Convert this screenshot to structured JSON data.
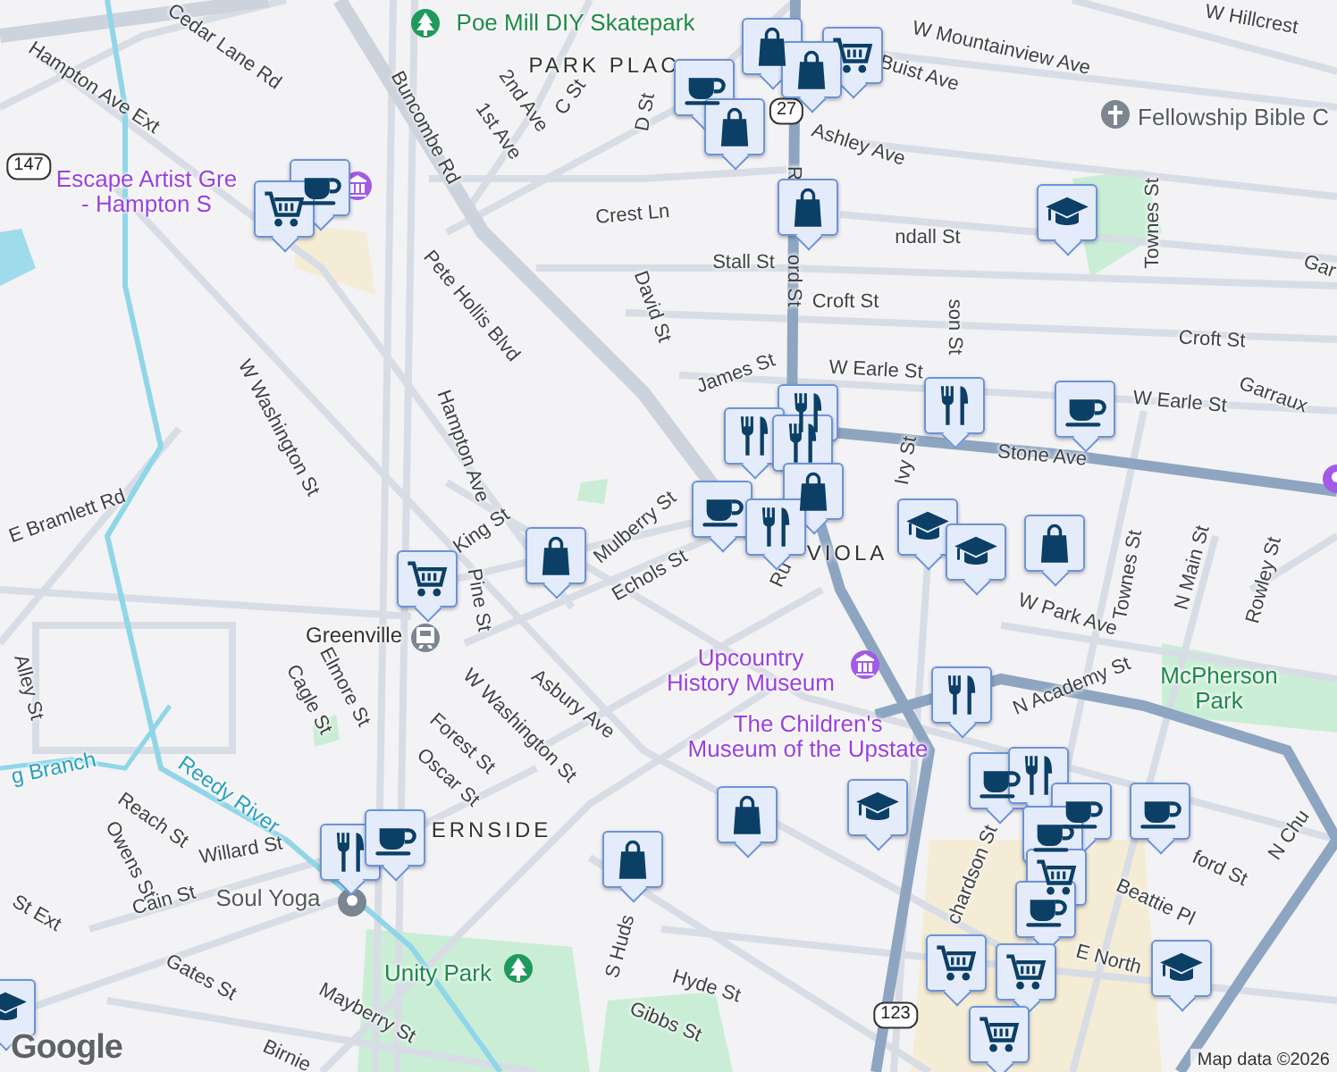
{
  "map": {
    "labels": [
      {
        "text": "Cedar Lane Rd",
        "kind": "street"
      },
      {
        "text": "Hampton Ave Ext",
        "kind": "street"
      },
      {
        "text": "147",
        "kind": "shield"
      },
      {
        "text": "Escape Artist Gre\n- Hampton S",
        "kind": "museum"
      },
      {
        "text": "Poe Mill DIY Skatepark",
        "kind": "park"
      },
      {
        "text": "PARK PLAC",
        "kind": "neighborhood"
      },
      {
        "text": "Buncombe Rd",
        "kind": "street"
      },
      {
        "text": "2nd Ave",
        "kind": "street"
      },
      {
        "text": "1st Ave",
        "kind": "street"
      },
      {
        "text": "C St",
        "kind": "street"
      },
      {
        "text": "D St",
        "kind": "street"
      },
      {
        "text": "W Mountainview Ave",
        "kind": "street"
      },
      {
        "text": "Buist Ave",
        "kind": "street"
      },
      {
        "text": "W Hillcrest",
        "kind": "street"
      },
      {
        "text": "Ashley Ave",
        "kind": "street"
      },
      {
        "text": "ndall St",
        "kind": "street"
      },
      {
        "text": "Fellowship Bible C",
        "kind": "place"
      },
      {
        "text": "Crest Ln",
        "kind": "street"
      },
      {
        "text": "Stall St",
        "kind": "street"
      },
      {
        "text": "Croft St",
        "kind": "street"
      },
      {
        "text": "Croft St",
        "kind": "street"
      },
      {
        "text": "David St",
        "kind": "street"
      },
      {
        "text": "Pete Hollis Blvd",
        "kind": "street"
      },
      {
        "text": "James St",
        "kind": "street"
      },
      {
        "text": "W Earle St",
        "kind": "street"
      },
      {
        "text": "W Earle St",
        "kind": "street"
      },
      {
        "text": "R",
        "kind": "street"
      },
      {
        "text": "ord St",
        "kind": "street"
      },
      {
        "text": "Gar",
        "kind": "street"
      },
      {
        "text": "Garraux",
        "kind": "street"
      },
      {
        "text": "son St",
        "kind": "street"
      },
      {
        "text": "Townes St",
        "kind": "street"
      },
      {
        "text": "Stone Ave",
        "kind": "street"
      },
      {
        "text": "Hampton Ave",
        "kind": "street"
      },
      {
        "text": "W Washington St",
        "kind": "street"
      },
      {
        "text": "E Bramlett Rd",
        "kind": "street"
      },
      {
        "text": "King St",
        "kind": "street"
      },
      {
        "text": "Mulberry St",
        "kind": "street"
      },
      {
        "text": "Echols St",
        "kind": "street"
      },
      {
        "text": "VIOLA",
        "kind": "neighborhood"
      },
      {
        "text": "Ru",
        "kind": "street"
      },
      {
        "text": "Pine St",
        "kind": "street"
      },
      {
        "text": "Ivy St",
        "kind": "street"
      },
      {
        "text": "W Park Ave",
        "kind": "street"
      },
      {
        "text": "Townes St",
        "kind": "street"
      },
      {
        "text": "N Main St",
        "kind": "street"
      },
      {
        "text": "Rowley St",
        "kind": "street"
      },
      {
        "text": "Greenville",
        "kind": "transit"
      },
      {
        "text": "Alley St",
        "kind": "street"
      },
      {
        "text": "Cagle St",
        "kind": "street"
      },
      {
        "text": "Elmore St",
        "kind": "street"
      },
      {
        "text": "Forest St",
        "kind": "street"
      },
      {
        "text": "Oscar St",
        "kind": "street"
      },
      {
        "text": "W Washington St",
        "kind": "street"
      },
      {
        "text": "Asbury Ave",
        "kind": "street"
      },
      {
        "text": "Upcountry\nHistory Museum",
        "kind": "museum"
      },
      {
        "text": "The Children's\nMuseum of the Upstate",
        "kind": "museum"
      },
      {
        "text": "N Academy St",
        "kind": "street"
      },
      {
        "text": "McPherson\nPark",
        "kind": "park"
      },
      {
        "text": "g Branch",
        "kind": "water"
      },
      {
        "text": "Reedy River",
        "kind": "water"
      },
      {
        "text": "Reach St",
        "kind": "street"
      },
      {
        "text": "Owens St",
        "kind": "street"
      },
      {
        "text": "Willard St",
        "kind": "street"
      },
      {
        "text": "Cain St",
        "kind": "street"
      },
      {
        "text": "St Ext",
        "kind": "street"
      },
      {
        "text": "ERNSIDE",
        "kind": "neighborhood"
      },
      {
        "text": "Soul Yoga",
        "kind": "place"
      },
      {
        "text": "Unity Park",
        "kind": "park"
      },
      {
        "text": "S Huds",
        "kind": "street"
      },
      {
        "text": "Hyde St",
        "kind": "street"
      },
      {
        "text": "Gibbs St",
        "kind": "street"
      },
      {
        "text": "Gates St",
        "kind": "street"
      },
      {
        "text": "Mayberry St",
        "kind": "street"
      },
      {
        "text": "Birnie",
        "kind": "street"
      },
      {
        "text": "ford St",
        "kind": "street"
      },
      {
        "text": "Beattie Pl",
        "kind": "street"
      },
      {
        "text": "E North",
        "kind": "street"
      },
      {
        "text": "chardson St",
        "kind": "street"
      },
      {
        "text": "N Chu",
        "kind": "street"
      },
      {
        "text": "123",
        "kind": "shield"
      },
      {
        "text": "27",
        "kind": "shield"
      }
    ],
    "markers": [
      {
        "kind": "cafe"
      },
      {
        "kind": "grocery"
      },
      {
        "kind": "shop"
      },
      {
        "kind": "grocery"
      },
      {
        "kind": "shop"
      },
      {
        "kind": "cafe"
      },
      {
        "kind": "shop"
      },
      {
        "kind": "shop"
      },
      {
        "kind": "school"
      },
      {
        "kind": "restaurant"
      },
      {
        "kind": "cafe"
      },
      {
        "kind": "restaurant"
      },
      {
        "kind": "restaurant"
      },
      {
        "kind": "restaurant"
      },
      {
        "kind": "shop"
      },
      {
        "kind": "cafe"
      },
      {
        "kind": "restaurant"
      },
      {
        "kind": "grocery"
      },
      {
        "kind": "shop"
      },
      {
        "kind": "school"
      },
      {
        "kind": "school"
      },
      {
        "kind": "shop"
      },
      {
        "kind": "restaurant"
      },
      {
        "kind": "shop"
      },
      {
        "kind": "school"
      },
      {
        "kind": "shop"
      },
      {
        "kind": "restaurant"
      },
      {
        "kind": "cafe"
      },
      {
        "kind": "cafe"
      },
      {
        "kind": "restaurant"
      },
      {
        "kind": "cafe"
      },
      {
        "kind": "cafe"
      },
      {
        "kind": "cafe"
      },
      {
        "kind": "grocery"
      },
      {
        "kind": "cafe"
      },
      {
        "kind": "grocery"
      },
      {
        "kind": "grocery"
      },
      {
        "kind": "grocery"
      },
      {
        "kind": "school"
      },
      {
        "kind": "school"
      }
    ],
    "logo": "Google",
    "attribution": "Map data ©2026"
  }
}
